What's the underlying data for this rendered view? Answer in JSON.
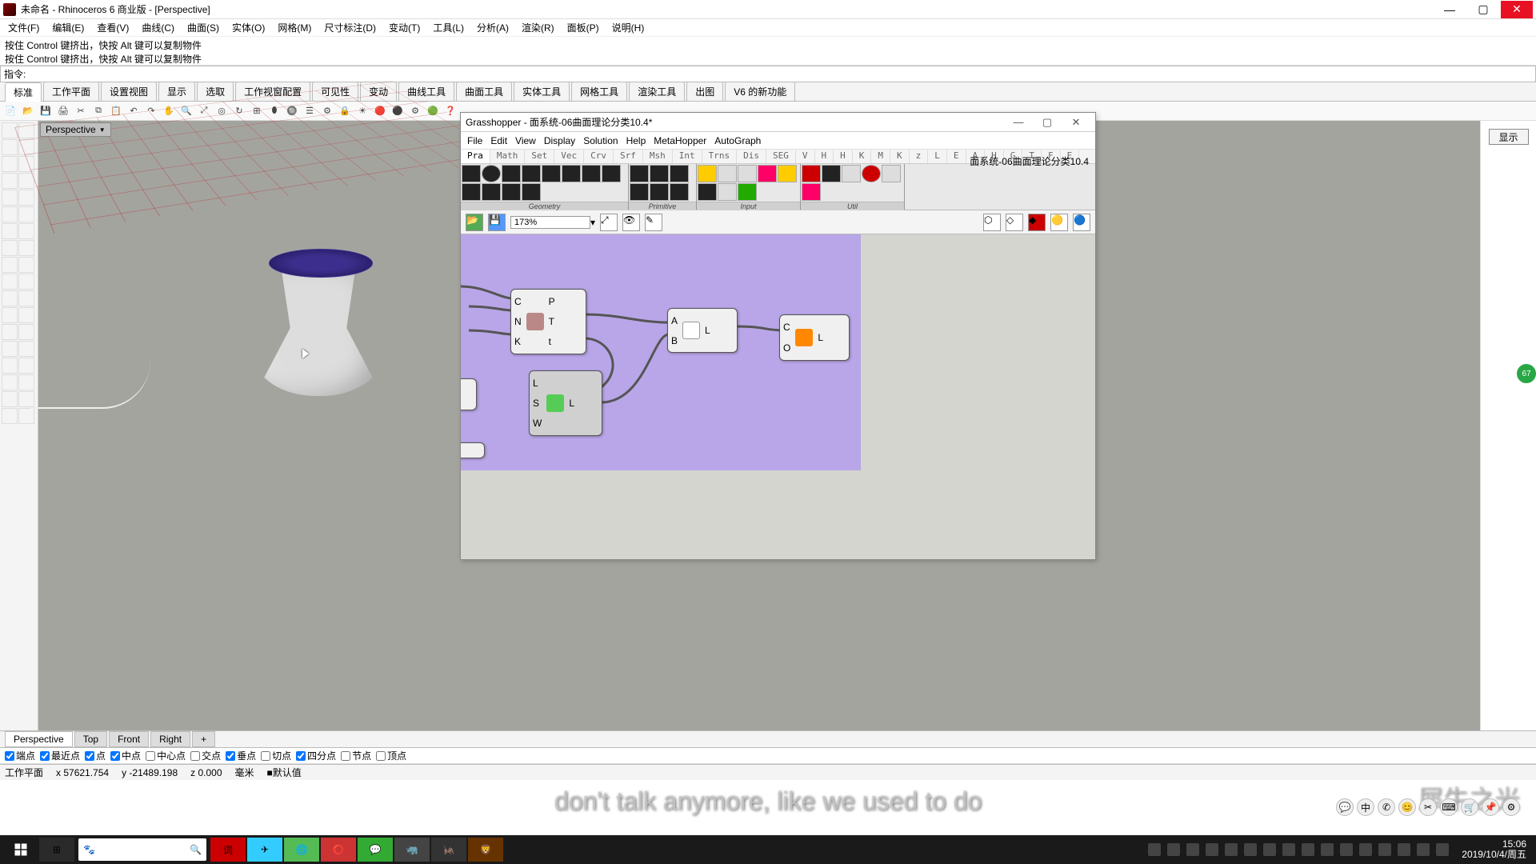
{
  "window": {
    "title": "未命名 - Rhinoceros 6 商业版 - [Perspective]",
    "min": "—",
    "max": "▢",
    "close": "✕"
  },
  "menus": [
    "文件(F)",
    "编辑(E)",
    "查看(V)",
    "曲线(C)",
    "曲面(S)",
    "实体(O)",
    "网格(M)",
    "尺寸标注(D)",
    "变动(T)",
    "工具(L)",
    "分析(A)",
    "渲染(R)",
    "面板(P)",
    "说明(H)"
  ],
  "cmd_history": {
    "line1": "按住 Control 键挤出，快按 Alt 键可以复制物件",
    "line2": "按住 Control 键挤出，快按 Alt 键可以复制物件"
  },
  "cmd_prompt": "指令:",
  "tabs": [
    "标准",
    "工作平面",
    "设置视图",
    "显示",
    "选取",
    "工作视窗配置",
    "可见性",
    "变动",
    "曲线工具",
    "曲面工具",
    "实体工具",
    "网格工具",
    "渲染工具",
    "出图",
    "V6 的新功能"
  ],
  "viewport": {
    "label": "Perspective"
  },
  "vp_tabs": [
    "Perspective",
    "Top",
    "Front",
    "Right",
    "+"
  ],
  "osnaps": [
    {
      "label": "端点",
      "checked": true
    },
    {
      "label": "最近点",
      "checked": true
    },
    {
      "label": "点",
      "checked": true
    },
    {
      "label": "中点",
      "checked": true
    },
    {
      "label": "中心点",
      "checked": false
    },
    {
      "label": "交点",
      "checked": false
    },
    {
      "label": "垂点",
      "checked": true
    },
    {
      "label": "切点",
      "checked": false
    },
    {
      "label": "四分点",
      "checked": true
    },
    {
      "label": "节点",
      "checked": false
    },
    {
      "label": "顶点",
      "checked": false
    }
  ],
  "status": {
    "plane": "工作平面",
    "x": "x 57621.754",
    "y": "y -21489.198",
    "z": "z 0.000",
    "unit": "毫米",
    "layer": "■默认值"
  },
  "gh": {
    "title": "Grasshopper - 面系统-06曲面理论分类10.4*",
    "min": "—",
    "max": "▢",
    "close": "✕",
    "right_label": "面系统-06曲面理论分类10.4",
    "menus": [
      "File",
      "Edit",
      "View",
      "Display",
      "Solution",
      "Help",
      "MetaHopper",
      "AutoGraph"
    ],
    "cats": [
      "Pra",
      "Math",
      "Set",
      "Vec",
      "Crv",
      "Srf",
      "Msh",
      "Int",
      "Trns",
      "Dis",
      "SEG",
      "V",
      "H",
      "H",
      "K",
      "M",
      "K",
      "z",
      "L",
      "E",
      "A",
      "H",
      "G",
      "T",
      "F",
      "E"
    ],
    "groups": [
      {
        "label": "Geometry",
        "count": 12
      },
      {
        "label": "Primitive",
        "count": 8
      },
      {
        "label": "Input",
        "count": 10
      },
      {
        "label": "Util",
        "count": 6
      }
    ],
    "zoom": "173%",
    "nodes": {
      "n1": {
        "in": [
          "C",
          "N",
          "K"
        ],
        "out": [
          "P",
          "T",
          "t"
        ]
      },
      "n2": {
        "in": [
          "L",
          "S",
          "W"
        ],
        "out": [
          "L"
        ]
      },
      "n3": {
        "in": [
          "A",
          "B"
        ],
        "out": [
          "L"
        ]
      },
      "n4": {
        "in": [
          "C",
          "O"
        ],
        "out": [
          "L"
        ]
      }
    }
  },
  "right_panel": {
    "display_btn": "显示"
  },
  "subtitle": "don't talk anymore, like we used to do",
  "watermark": "犀牛之光",
  "badge": "67",
  "taskbar": {
    "datetime": {
      "time": "15:06",
      "date": "2019/10/4/周五"
    }
  }
}
